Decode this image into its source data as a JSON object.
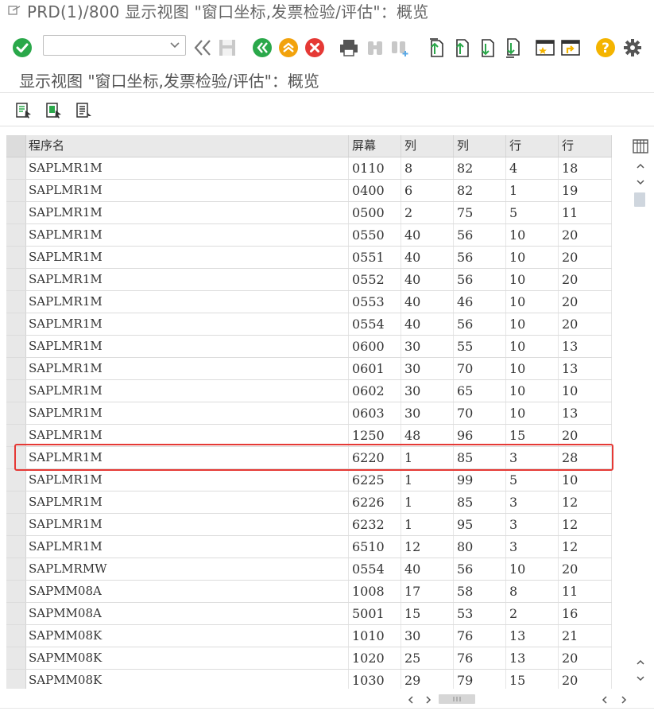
{
  "window": {
    "title": "PRD(1)/800 显示视图 \"窗口坐标,发票检验/评估\"：概览"
  },
  "toolbar": {
    "command_value": "",
    "icons": [
      "enter-check-icon",
      "back-double-chevron-icon",
      "save-icon",
      "back-icon",
      "exit-icon",
      "cancel-icon",
      "print-icon",
      "find-icon",
      "find-next-icon",
      "first-page-icon",
      "previous-page-icon",
      "next-page-icon",
      "last-page-icon",
      "new-session-icon",
      "shortcut-icon",
      "help-icon",
      "settings-gear-icon"
    ],
    "colors": {
      "green": "#2aa84a",
      "orange": "#f2a20c",
      "red": "#e53935",
      "teal": "#1f9e8a",
      "yellow": "#f4b400"
    }
  },
  "screen": {
    "title": "显示视图 \"窗口坐标,发票检验/评估\"：概览"
  },
  "app_toolbar": {
    "icons": [
      "select-detail-icon",
      "display-icon",
      "change-icon"
    ]
  },
  "table": {
    "columns": [
      "程序名",
      "屏幕",
      "列",
      "列",
      "行",
      "行"
    ],
    "rows": [
      [
        "SAPLMR1M",
        "0110",
        "8",
        "82",
        "4",
        "18"
      ],
      [
        "SAPLMR1M",
        "0400",
        "6",
        "82",
        "1",
        "19"
      ],
      [
        "SAPLMR1M",
        "0500",
        "2",
        "75",
        "5",
        "11"
      ],
      [
        "SAPLMR1M",
        "0550",
        "40",
        "56",
        "10",
        "20"
      ],
      [
        "SAPLMR1M",
        "0551",
        "40",
        "56",
        "10",
        "20"
      ],
      [
        "SAPLMR1M",
        "0552",
        "40",
        "56",
        "10",
        "20"
      ],
      [
        "SAPLMR1M",
        "0553",
        "40",
        "46",
        "10",
        "20"
      ],
      [
        "SAPLMR1M",
        "0554",
        "40",
        "56",
        "10",
        "20"
      ],
      [
        "SAPLMR1M",
        "0600",
        "30",
        "55",
        "10",
        "13"
      ],
      [
        "SAPLMR1M",
        "0601",
        "30",
        "70",
        "10",
        "13"
      ],
      [
        "SAPLMR1M",
        "0602",
        "30",
        "65",
        "10",
        "10"
      ],
      [
        "SAPLMR1M",
        "0603",
        "30",
        "70",
        "10",
        "13"
      ],
      [
        "SAPLMR1M",
        "1250",
        "48",
        "96",
        "15",
        "20"
      ],
      [
        "SAPLMR1M",
        "6220",
        "1",
        "85",
        "3",
        "28"
      ],
      [
        "SAPLMR1M",
        "6225",
        "1",
        "99",
        "5",
        "10"
      ],
      [
        "SAPLMR1M",
        "6226",
        "1",
        "85",
        "3",
        "12"
      ],
      [
        "SAPLMR1M",
        "6232",
        "1",
        "95",
        "3",
        "12"
      ],
      [
        "SAPLMR1M",
        "6510",
        "12",
        "80",
        "3",
        "12"
      ],
      [
        "SAPLMRMW",
        "0554",
        "40",
        "56",
        "10",
        "20"
      ],
      [
        "SAPMM08A",
        "1008",
        "17",
        "58",
        "8",
        "11"
      ],
      [
        "SAPMM08A",
        "5001",
        "15",
        "53",
        "2",
        "16"
      ],
      [
        "SAPMM08K",
        "1010",
        "30",
        "76",
        "13",
        "21"
      ],
      [
        "SAPMM08K",
        "1020",
        "25",
        "76",
        "13",
        "20"
      ],
      [
        "SAPMM08K",
        "1030",
        "29",
        "79",
        "15",
        "20"
      ]
    ],
    "highlighted_row": 13,
    "highlight_color": "#e53935"
  }
}
